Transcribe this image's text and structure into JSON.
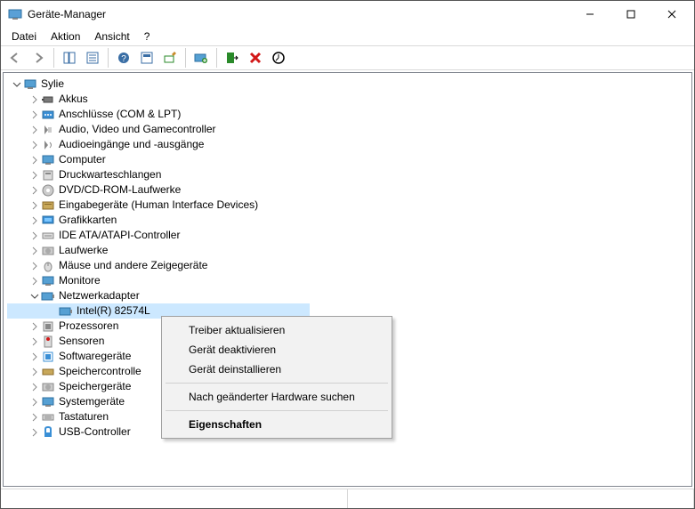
{
  "window": {
    "title": "Geräte-Manager"
  },
  "menu": {
    "file": "Datei",
    "action": "Aktion",
    "view": "Ansicht",
    "help": "?"
  },
  "tree": {
    "root": "Sylie",
    "categories": [
      "Akkus",
      "Anschlüsse (COM & LPT)",
      "Audio, Video und Gamecontroller",
      "Audioeingänge und -ausgänge",
      "Computer",
      "Druckwarteschlangen",
      "DVD/CD-ROM-Laufwerke",
      "Eingabegeräte (Human Interface Devices)",
      "Grafikkarten",
      "IDE ATA/ATAPI-Controller",
      "Laufwerke",
      "Mäuse und andere Zeigegeräte",
      "Monitore"
    ],
    "network_label": "Netzwerkadapter",
    "network_device": "Intel(R) 82574L",
    "categories_after": [
      "Prozessoren",
      "Sensoren",
      "Softwaregeräte",
      "Speichercontrolle",
      "Speichergeräte",
      "Systemgeräte",
      "Tastaturen",
      "USB-Controller"
    ]
  },
  "context": {
    "update": "Treiber aktualisieren",
    "disable": "Gerät deaktivieren",
    "uninstall": "Gerät deinstallieren",
    "scan": "Nach geänderter Hardware suchen",
    "properties": "Eigenschaften"
  }
}
